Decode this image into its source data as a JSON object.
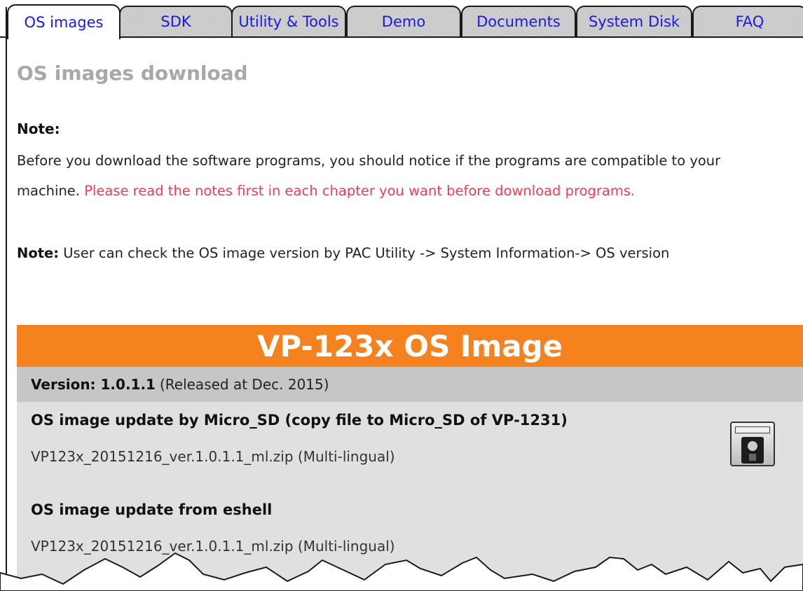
{
  "tabs": [
    {
      "label": "OS images",
      "active": true
    },
    {
      "label": "SDK",
      "active": false
    },
    {
      "label": "Utility & Tools",
      "active": false
    },
    {
      "label": "Demo",
      "active": false
    },
    {
      "label": "Documents",
      "active": false
    },
    {
      "label": "System Disk",
      "active": false
    },
    {
      "label": "FAQ",
      "active": false
    }
  ],
  "page": {
    "heading": "OS images download",
    "note_title": "Note:",
    "note_text": "Before you download the software programs, you should notice if the programs are compatible to your machine.",
    "note_highlight": "Please read the notes first in each chapter you want before download programs.",
    "note2_label": "Note:",
    "note2_text": "User can check the OS image version by PAC Utility -> System Information-> OS version"
  },
  "image_panel": {
    "title": "VP-123x OS Image",
    "version_label": "Version: 1.0.1.1",
    "version_note": "(Released at Dec. 2015)",
    "sections": [
      {
        "title": "OS image update by Micro_SD (copy file to Micro_SD of VP-1231)",
        "file": "VP123x_20151216_ver.1.0.1.1_ml.zip (Multi-lingual)"
      },
      {
        "title": "OS image update from eshell",
        "file": "VP123x_20151216_ver.1.0.1.1_ml.zip (Multi-lingual)"
      }
    ],
    "icon": "sd-card-icon"
  },
  "colors": {
    "tab_text": "#1a1ae6",
    "banner": "#f5821f",
    "highlight": "#f03c50",
    "version_bar": "#c6c6c6",
    "panel_bg": "#e0e0e0"
  }
}
